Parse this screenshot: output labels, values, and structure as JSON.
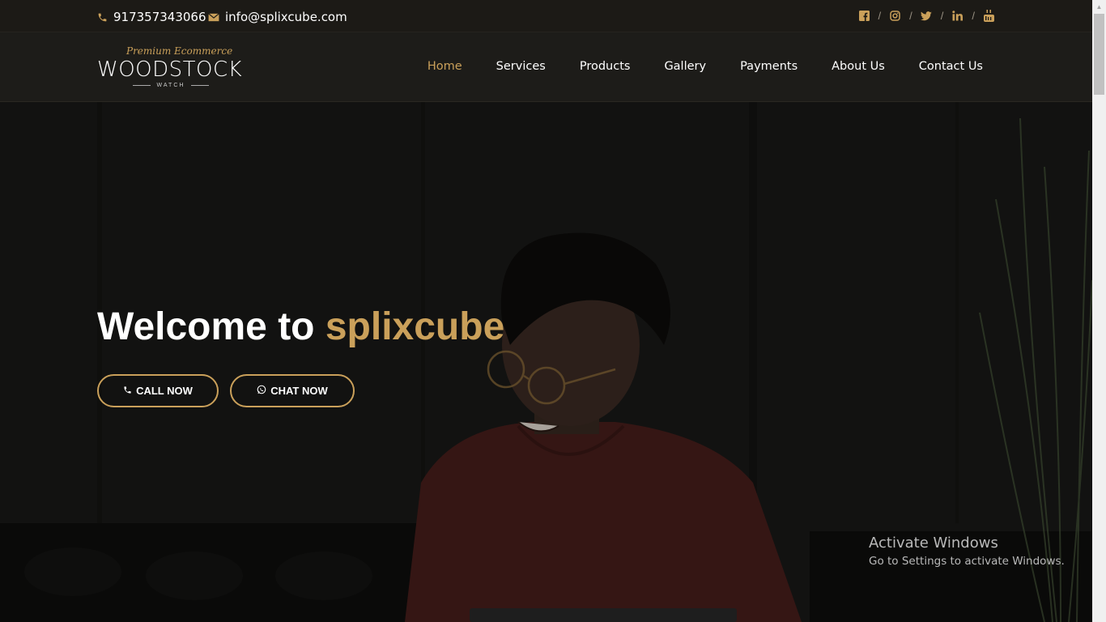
{
  "topbar": {
    "phone": "917357343066",
    "email": "info@splixcube.com",
    "icons": {
      "phone": "phone-icon",
      "email": "envelope-icon"
    },
    "social": [
      "facebook-icon",
      "instagram-icon",
      "twitter-icon",
      "linkedin-icon",
      "youtube-icon"
    ],
    "separator": "/"
  },
  "logo": {
    "tagline": "Premium Ecommerce",
    "wordmark": "WOODSTOCK",
    "sub": "WATCH"
  },
  "nav": {
    "items": [
      "Home",
      "Services",
      "Products",
      "Gallery",
      "Payments",
      "About Us",
      "Contact Us"
    ],
    "active": "Home"
  },
  "hero": {
    "title_prefix": "Welcome to ",
    "title_accent": "splixcube",
    "call_label": "CALL NOW",
    "chat_label": "CHAT NOW"
  },
  "watermark": {
    "line1": "Activate Windows",
    "line2": "Go to Settings to activate Windows."
  },
  "colors": {
    "accent": "#caa05a",
    "topbar_bg": "#1c1a16",
    "navbar_bg": "#1d1c19",
    "hero_bg": "#171715"
  }
}
